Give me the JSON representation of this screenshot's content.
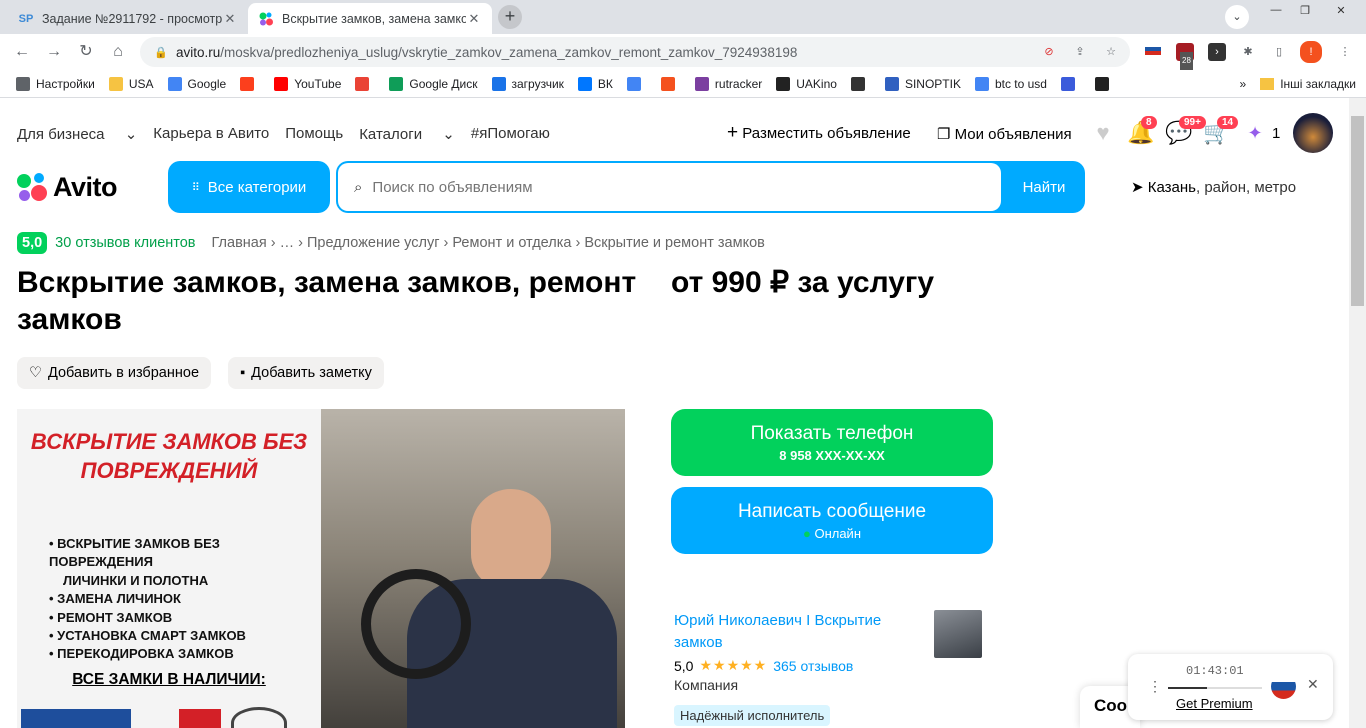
{
  "browser": {
    "tabs": [
      {
        "icon": "SP",
        "title": "Задание №2911792 - просмотр"
      },
      {
        "icon": "avito",
        "title": "Вскрытие замков, замена замко"
      }
    ],
    "url_host": "avito.ru",
    "url_path": "/moskva/predlozheniya_uslug/vskrytie_zamkov_zamena_zamkov_remont_zamkov_7924938198",
    "ext_badge": "28",
    "bookmarks": [
      {
        "label": "Настройки",
        "icon": "gear-icon",
        "color": "#5f6368"
      },
      {
        "label": "USA",
        "icon": "folder-icon",
        "color": "#f6c342"
      },
      {
        "label": "Google",
        "icon": "google-icon",
        "color": "#4285f4"
      },
      {
        "label": "",
        "icon": "yandex-icon",
        "color": "#fc3f1d"
      },
      {
        "label": "YouTube",
        "icon": "youtube-icon",
        "color": "#ff0000"
      },
      {
        "label": "",
        "icon": "gmail-icon",
        "color": "#ea4335"
      },
      {
        "label": "Google Диск",
        "icon": "drive-icon",
        "color": "#0f9d58"
      },
      {
        "label": "загрузчик",
        "icon": "infinity-icon",
        "color": "#1a73e8"
      },
      {
        "label": "ВК",
        "icon": "vk-icon",
        "color": "#0077ff"
      },
      {
        "label": "",
        "icon": "translate-icon",
        "color": "#4285f4"
      },
      {
        "label": "",
        "icon": "f-icon",
        "color": "#f4511e"
      },
      {
        "label": "rutracker",
        "icon": "rutracker-icon",
        "color": "#7b3fa0"
      },
      {
        "label": "UAKino",
        "icon": "uakino-icon",
        "color": "#222222"
      },
      {
        "label": "",
        "icon": "chess-icon",
        "color": "#333333"
      },
      {
        "label": "SINOPTIK",
        "icon": "thermometer-icon",
        "color": "#3060c0"
      },
      {
        "label": "btc to usd",
        "icon": "google-icon",
        "color": "#4285f4"
      },
      {
        "label": "",
        "icon": "arrow-icon",
        "color": "#3b5bdb"
      },
      {
        "label": "",
        "icon": "bc-icon",
        "color": "#222222"
      }
    ],
    "more_bookmarks": "»",
    "other_bookmarks": "Інші закладки"
  },
  "header": {
    "links": [
      "Для бизнеса",
      "Карьера в Авито",
      "Помощь",
      "Каталоги",
      "#яПомогаю"
    ],
    "post_ad": "Разместить объявление",
    "my_ads": "Мои объявления",
    "badges": {
      "notifications": "8",
      "messages": "99+",
      "cart": "14"
    },
    "bonus_count": "1",
    "logo_text": "Avito",
    "all_categories": "Все категории",
    "search_placeholder": "Поиск по объявлениям",
    "search_button": "Найти",
    "location_city": "Казань",
    "location_rest": ", район, метро"
  },
  "listing": {
    "score": "5,0",
    "reviews_link": "30 отзывов клиентов",
    "breadcrumbs": "Главная  ›  …  ›  Предложение услуг  ›  Ремонт и отделка  ›  Вскрытие и ремонт замков",
    "title": "Вскрытие замков, замена замков, ремонт замков",
    "price": "от 990 ₽ за услугу",
    "add_favorite": "Добавить в избранное",
    "add_note": "Добавить заметку",
    "photo": {
      "headline": "ВСКРЫТИЕ ЗАМКОВ БЕЗ ПОВРЕЖДЕНИЙ",
      "items": [
        "ВСКРЫТИЕ ЗАМКОВ БЕЗ ПОВРЕЖДЕНИЯ",
        "ЛИЧИНКИ И ПОЛОТНА",
        "ЗАМЕНА ЛИЧИНОК",
        "РЕМОНТ ЗАМКОВ",
        "УСТАНОВКА СМАРТ ЗАМКОВ",
        "ПЕРЕКОДИРОВКА ЗАМКОВ"
      ],
      "bottom": "ВСЕ ЗАМКИ В НАЛИЧИИ:"
    },
    "show_phone": "Показать телефон",
    "phone_masked": "8 958 XXX-XX-XX",
    "write_message": "Написать сообщение",
    "online": "Онлайн",
    "seller_name": "Юрий Николаевич I Вскрытие замков",
    "seller_score": "5,0",
    "stars": "★★★★★",
    "seller_reviews": "365 отзывов",
    "seller_type": "Компания",
    "reliable_badge": "Надёжный исполнитель"
  },
  "overlay": {
    "chat_partial": "Coo",
    "player_time": "01:43:01",
    "player_progress": 0.42,
    "premium": "Get Premium"
  }
}
